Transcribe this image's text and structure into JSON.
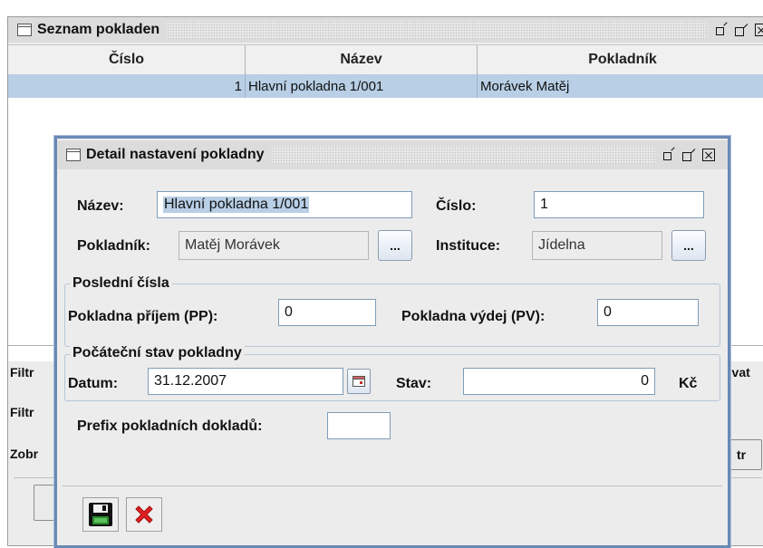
{
  "list_window": {
    "title": "Seznam pokladen",
    "columns": [
      "Číslo",
      "Název",
      "Pokladník"
    ],
    "rows": [
      {
        "cislo": "1",
        "nazev": "Hlavní pokladna 1/001",
        "pokladnik": "Morávek Matěj"
      }
    ],
    "left_labels": [
      "Filtr",
      "Filtr",
      "Zobr"
    ],
    "right_fragments": [
      "ovat",
      "tr"
    ]
  },
  "dialog": {
    "title": "Detail nastavení pokladny",
    "nazev": {
      "label": "Název:",
      "value": "Hlavní pokladna 1/001"
    },
    "cislo": {
      "label": "Číslo:",
      "value": "1"
    },
    "pokladnik": {
      "label": "Pokladník:",
      "value": "Matěj Morávek",
      "button": "..."
    },
    "instituce": {
      "label": "Instituce:",
      "value": "Jídelna",
      "button": "..."
    },
    "posledni_cisla": {
      "title": "Poslední čísla",
      "prijem": {
        "label": "Pokladna příjem (PP):",
        "value": "0"
      },
      "vydej": {
        "label": "Pokladna výdej (PV):",
        "value": "0"
      }
    },
    "pocatecni_stav": {
      "title": "Počáteční stav pokladny",
      "datum": {
        "label": "Datum:",
        "value": "31.12.2007"
      },
      "stav": {
        "label": "Stav:",
        "value": "0",
        "currency": "Kč"
      }
    },
    "prefix": {
      "label": "Prefix pokladních dokladů:",
      "value": ""
    },
    "toolbar": {
      "save_icon": "floppy-disk-icon",
      "cancel_icon": "red-x-icon"
    }
  },
  "colors": {
    "selection": "#b8cfe5",
    "dialog_border": "#6a89b5",
    "cancel_red": "#e02020"
  }
}
